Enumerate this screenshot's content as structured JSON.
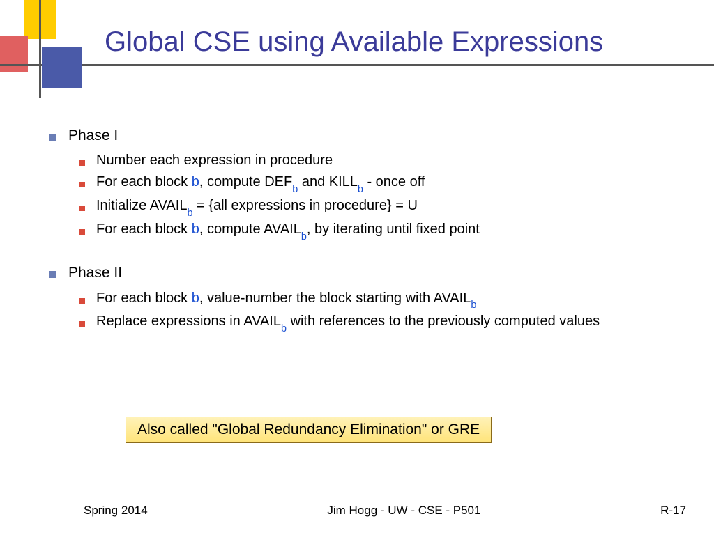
{
  "title": "Global CSE using Available Expressions",
  "phases": [
    {
      "heading": "Phase I",
      "items": [
        {
          "segments": [
            {
              "t": "Number each expression in procedure"
            }
          ]
        },
        {
          "segments": [
            {
              "t": "For each block "
            },
            {
              "t": "b",
              "cls": "bvar"
            },
            {
              "t": ", compute DEF"
            },
            {
              "t": "b",
              "sub": true,
              "cls": "bvar"
            },
            {
              "t": " and KILL"
            },
            {
              "t": "b",
              "sub": true,
              "cls": "bvar"
            },
            {
              "t": " - once off"
            }
          ]
        },
        {
          "segments": [
            {
              "t": "Initialize AVAIL"
            },
            {
              "t": "b",
              "sub": true,
              "cls": "bvar"
            },
            {
              "t": " = {all expressions in procedure} = U"
            }
          ]
        },
        {
          "segments": [
            {
              "t": "For each block "
            },
            {
              "t": "b",
              "cls": "bvar"
            },
            {
              "t": ", compute AVAIL"
            },
            {
              "t": "b",
              "sub": true,
              "cls": "bvar"
            },
            {
              "t": ", by iterating until fixed point"
            }
          ]
        }
      ]
    },
    {
      "heading": "Phase II",
      "items": [
        {
          "segments": [
            {
              "t": "For each block "
            },
            {
              "t": "b",
              "cls": "bvar"
            },
            {
              "t": ", value-number the block starting with AVAIL"
            },
            {
              "t": "b",
              "sub": true,
              "cls": "bvar"
            }
          ]
        },
        {
          "segments": [
            {
              "t": "Replace expressions in AVAIL"
            },
            {
              "t": "b",
              "sub": true,
              "cls": "bvar"
            },
            {
              "t": " with references to the previously computed values"
            }
          ]
        }
      ]
    }
  ],
  "callout": "Also called \"Global Redundancy Elimination\" or GRE",
  "footer": {
    "left": "Spring 2014",
    "center": "Jim Hogg - UW - CSE - P501",
    "right": "R-17"
  }
}
